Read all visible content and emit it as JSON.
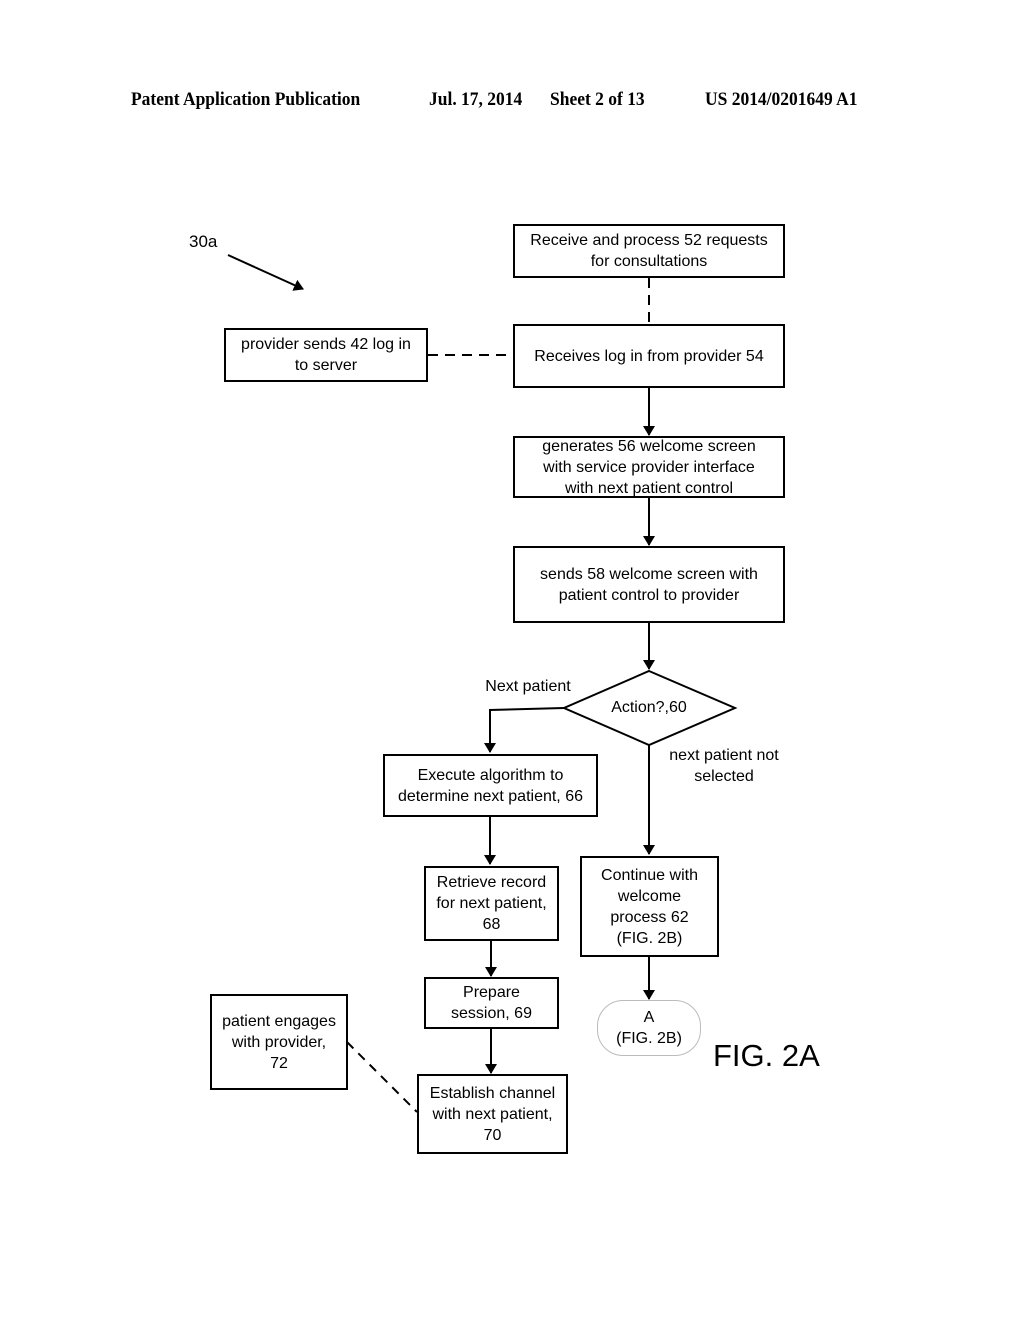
{
  "header": {
    "publication": "Patent Application Publication",
    "date": "Jul. 17, 2014",
    "sheet": "Sheet 2 of 13",
    "number": "US 2014/0201649 A1"
  },
  "diagram": {
    "ref_label": "30a",
    "figure_label": "FIG. 2A",
    "nodes": {
      "n52": "Receive and process 52 requests\nfor consultations",
      "n42": "provider sends 42 log in\nto server",
      "n54": "Receives log in from provider 54",
      "n56": "generates 56 welcome screen\nwith service provider interface\nwith next patient control",
      "n58": "sends 58 welcome screen with\npatient control to provider",
      "n60": "Action?,60",
      "n66": "Execute algorithm to\ndetermine next patient, 66",
      "n62": "Continue with\nwelcome\nprocess 62\n(FIG. 2B)",
      "n68": "Retrieve record\nfor next patient,\n68",
      "n69": "Prepare\nsession, 69",
      "n70": "Establish channel\nwith next patient,\n70",
      "n72": "patient engages\nwith provider,\n72",
      "nA": "A\n(FIG. 2B)"
    },
    "edge_labels": {
      "yes": "Next patient",
      "no": "next patient not\nselected"
    },
    "edges": [
      {
        "from": "n52",
        "to": "n54",
        "style": "dashed"
      },
      {
        "from": "n42",
        "to": "n54",
        "style": "dashed"
      },
      {
        "from": "n54",
        "to": "n56",
        "style": "arrow"
      },
      {
        "from": "n56",
        "to": "n58",
        "style": "arrow"
      },
      {
        "from": "n58",
        "to": "n60",
        "style": "arrow"
      },
      {
        "from": "n60",
        "to": "n66",
        "style": "arrow",
        "label": "Next patient"
      },
      {
        "from": "n60",
        "to": "n62",
        "style": "arrow",
        "label": "next patient not selected"
      },
      {
        "from": "n66",
        "to": "n68",
        "style": "arrow"
      },
      {
        "from": "n68",
        "to": "n69",
        "style": "arrow"
      },
      {
        "from": "n69",
        "to": "n70",
        "style": "arrow"
      },
      {
        "from": "n62",
        "to": "nA",
        "style": "arrow"
      },
      {
        "from": "n72",
        "to": "n70",
        "style": "dashed"
      }
    ]
  }
}
